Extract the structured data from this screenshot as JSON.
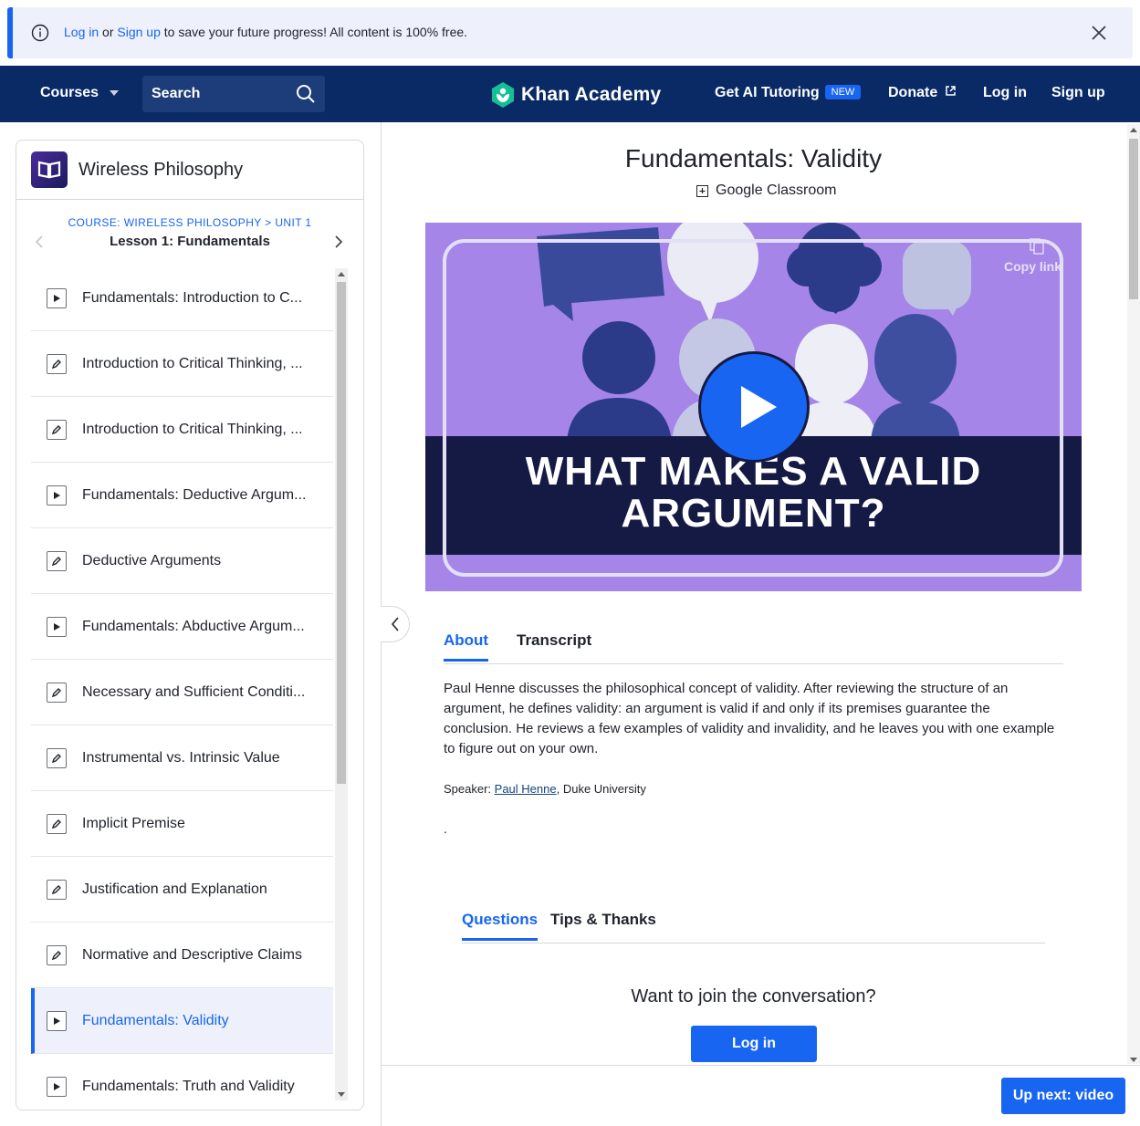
{
  "banner": {
    "login_link": "Log in",
    "or_text": " or ",
    "signup_link": "Sign up",
    "message": " to save your future progress! All content is 100% free."
  },
  "header": {
    "courses_label": "Courses",
    "search_label": "Search",
    "logo_text": "Khan Academy",
    "ai_tutoring_label": "Get AI Tutoring",
    "new_badge": "NEW",
    "donate_label": "Donate",
    "login_label": "Log in",
    "signup_label": "Sign up"
  },
  "sidebar": {
    "course_title": "Wireless Philosophy",
    "breadcrumb": "COURSE: WIRELESS PHILOSOPHY > UNIT 1",
    "lesson_title": "Lesson 1: Fundamentals",
    "items": [
      {
        "label": "Fundamentals: Introduction to C...",
        "type": "video"
      },
      {
        "label": "Introduction to Critical Thinking, ...",
        "type": "article"
      },
      {
        "label": "Introduction to Critical Thinking, ...",
        "type": "article"
      },
      {
        "label": "Fundamentals: Deductive Argum...",
        "type": "video"
      },
      {
        "label": "Deductive Arguments",
        "type": "article"
      },
      {
        "label": "Fundamentals: Abductive Argum...",
        "type": "video"
      },
      {
        "label": "Necessary and Sufficient Conditi...",
        "type": "article"
      },
      {
        "label": "Instrumental vs. Intrinsic Value",
        "type": "article"
      },
      {
        "label": "Implicit Premise",
        "type": "article"
      },
      {
        "label": "Justification and Explanation",
        "type": "article"
      },
      {
        "label": "Normative and Descriptive Claims",
        "type": "article"
      },
      {
        "label": "Fundamentals: Validity",
        "type": "video",
        "active": true
      },
      {
        "label": "Fundamentals: Truth and Validity",
        "type": "video"
      }
    ]
  },
  "main": {
    "title": "Fundamentals: Validity",
    "google_classroom": "Google Classroom",
    "video": {
      "headline_line1": "WHAT MAKES A VALID",
      "headline_line2": "ARGUMENT?",
      "copy_link": "Copy link"
    },
    "tabs": [
      {
        "label": "About",
        "active": true
      },
      {
        "label": "Transcript",
        "active": false
      }
    ],
    "about_text": "Paul Henne discusses the philosophical concept of validity. After reviewing the structure of an argument, he defines validity: an argument is valid if and only if its premises guarantee the conclusion. He reviews a few examples of validity and invalidity, and he leaves you with one example to figure out on your own.",
    "speaker_prefix": "Speaker: ",
    "speaker_name": "Paul Henne",
    "speaker_suffix": ", Duke University",
    "dot": ".",
    "discussion_tabs": [
      {
        "label": "Questions",
        "active": true
      },
      {
        "label": "Tips & Thanks",
        "active": false
      }
    ],
    "join_prompt": "Want to join the conversation?",
    "login_button": "Log in",
    "up_next": "Up next: video"
  },
  "colors": {
    "brand_blue": "#1865f2",
    "header_navy": "#0a2a66",
    "video_purple": "#a585e8",
    "video_band": "#151a45"
  }
}
